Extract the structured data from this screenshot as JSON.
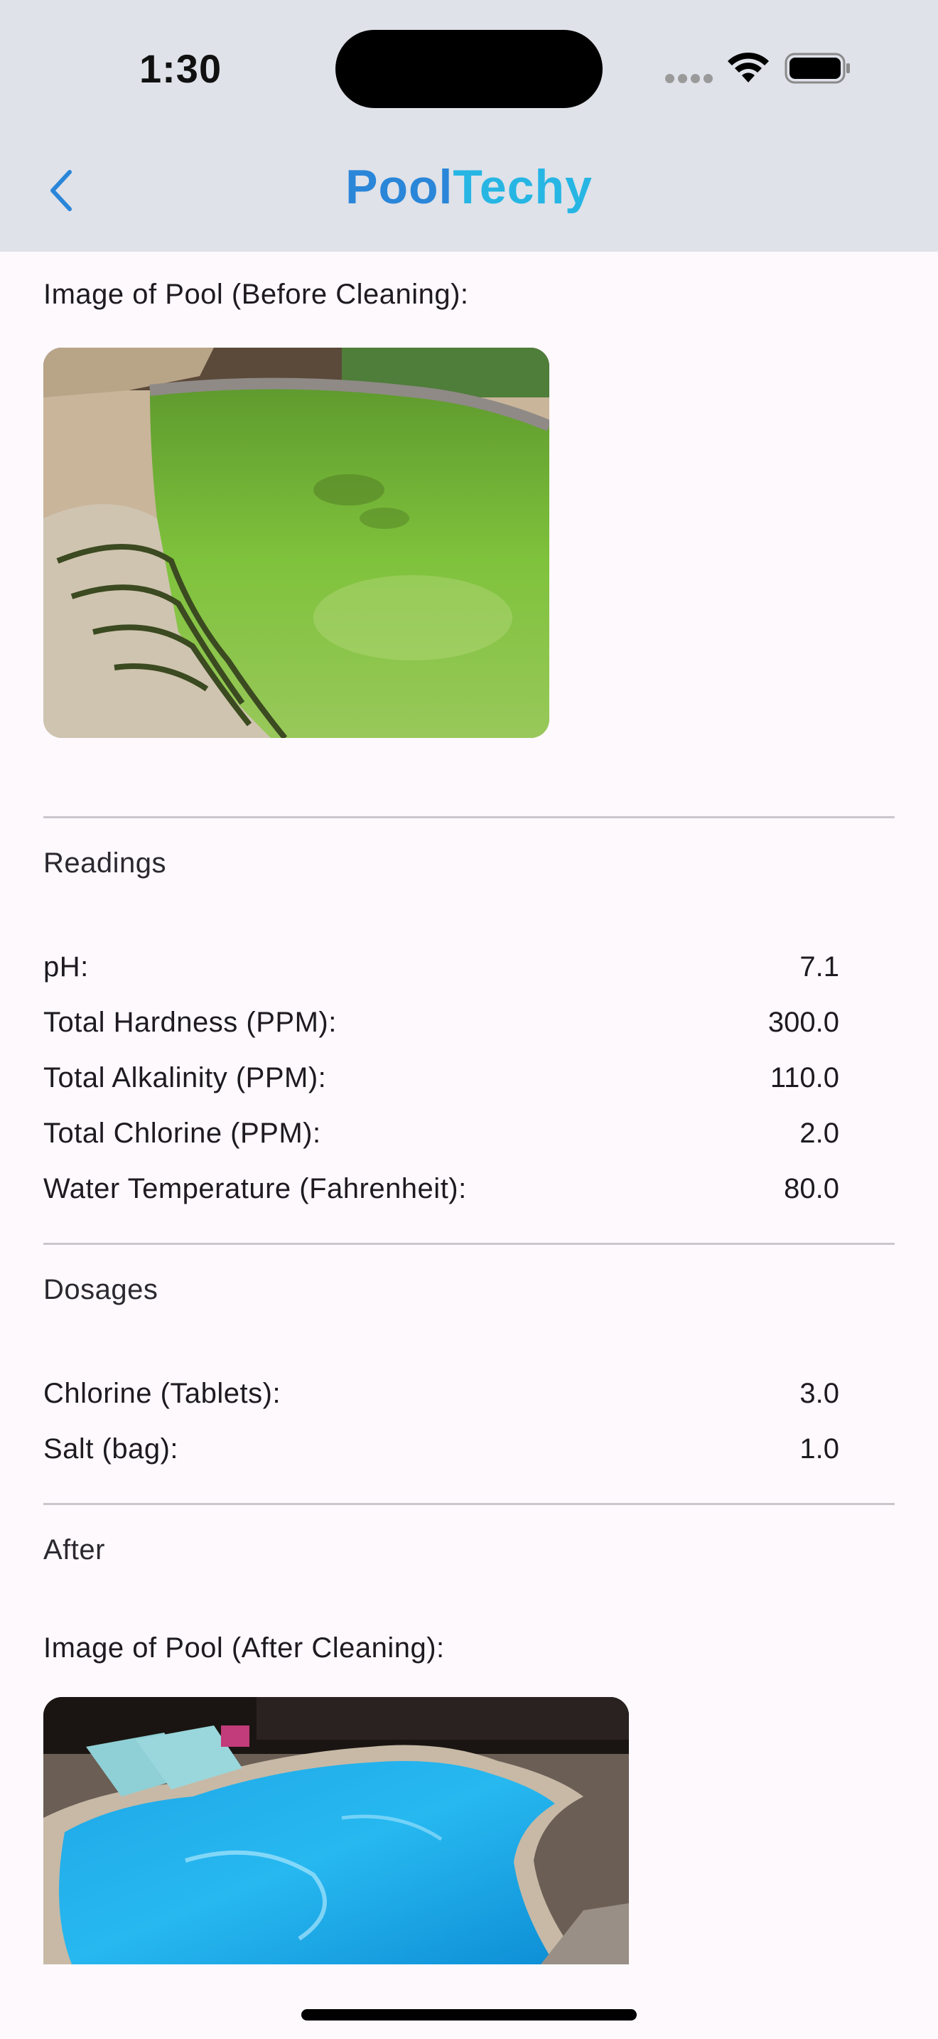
{
  "status_bar": {
    "time": "1:30"
  },
  "nav": {
    "title_part1": "Pool",
    "title_part2": "Techy",
    "back_icon": "chevron-left-icon"
  },
  "before": {
    "image_label": "Image of Pool (Before Cleaning):"
  },
  "readings": {
    "title": "Readings",
    "rows": [
      {
        "label": "pH:",
        "value": "7.1"
      },
      {
        "label": "Total Hardness (PPM):",
        "value": "300.0"
      },
      {
        "label": "Total Alkalinity (PPM):",
        "value": "110.0"
      },
      {
        "label": "Total Chlorine (PPM):",
        "value": "2.0"
      },
      {
        "label": "Water Temperature (Fahrenheit):",
        "value": "80.0"
      }
    ]
  },
  "dosages": {
    "title": "Dosages",
    "rows": [
      {
        "label": "Chlorine (Tablets):",
        "value": "3.0"
      },
      {
        "label": "Salt (bag):",
        "value": "1.0"
      }
    ]
  },
  "after": {
    "title": "After",
    "image_label": "Image of Pool (After Cleaning):"
  },
  "colors": {
    "accent": "#2a86d8",
    "accent_light": "#27b6e4",
    "header_bg": "#dfe2e9",
    "page_bg": "#fdf9fd",
    "divider": "#c9c6cc"
  }
}
